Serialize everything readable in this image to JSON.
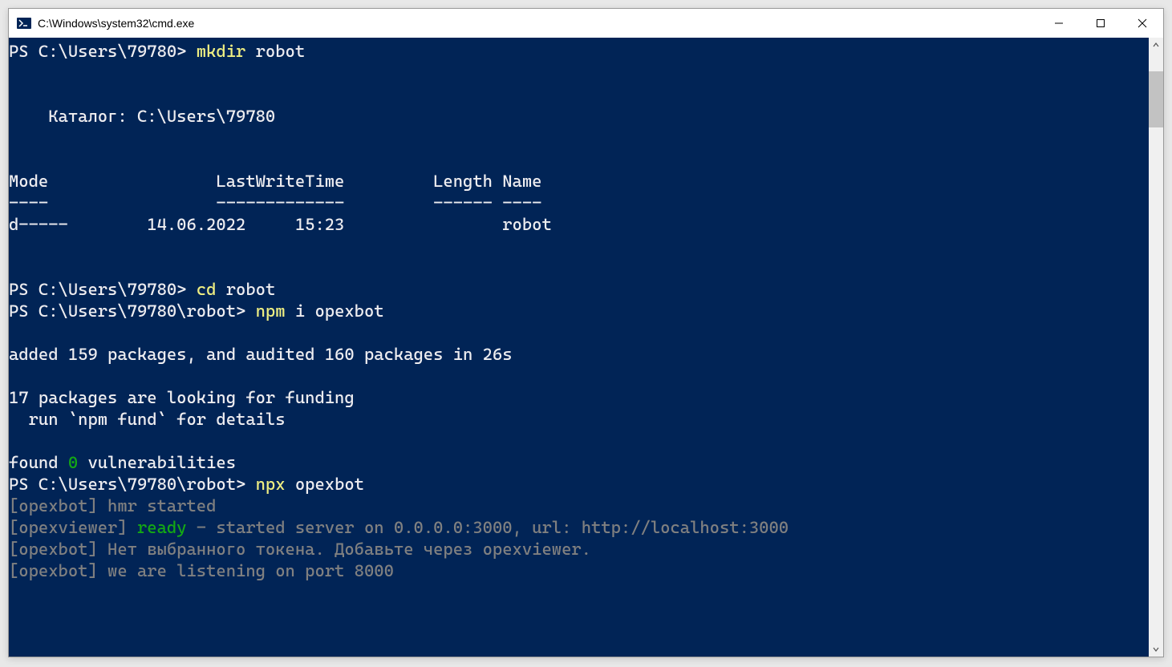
{
  "window": {
    "title": "C:\\Windows\\system32\\cmd.exe"
  },
  "terminal": {
    "prompt1": "PS C:\\Users\\79780> ",
    "cmd1_part1": "mkdir ",
    "cmd1_part2": "robot",
    "blank1": "",
    "blank2": "",
    "dir_header": "    Каталог: C:\\Users\\79780",
    "blank3": "",
    "blank4": "",
    "table_header": "Mode                 LastWriteTime         Length Name",
    "table_divider": "----                 -------------         ------ ----",
    "table_row1": "d-----        14.06.2022     15:23                robot",
    "blank5": "",
    "blank6": "",
    "prompt2": "PS C:\\Users\\79780> ",
    "cmd2_part1": "cd ",
    "cmd2_part2": "robot",
    "prompt3": "PS C:\\Users\\79780\\robot> ",
    "cmd3_part1": "npm ",
    "cmd3_part2": "i opexbot",
    "blank7": "",
    "npm_added": "added 159 packages, and audited 160 packages in 26s",
    "blank8": "",
    "npm_funding1": "17 packages are looking for funding",
    "npm_funding2": "  run `npm fund` for details",
    "blank9": "",
    "vuln_prefix": "found ",
    "vuln_count": "0",
    "vuln_suffix": " vulnerabilities",
    "prompt4": "PS C:\\Users\\79780\\robot> ",
    "cmd4_part1": "npx ",
    "cmd4_part2": "opexbot",
    "hmr_line": "[opexbot] hmr started",
    "opexviewer_prefix": "[opexviewer] ",
    "opexviewer_ready": "ready",
    "opexviewer_suffix": " - started server on 0.0.0.0:3000, url: http://localhost:3000",
    "opexbot_token": "[opexbot] Нет выбранного токена. Добавьте через opexviewer.",
    "opexbot_listen": "[opexbot] we are listening on port 8000"
  }
}
